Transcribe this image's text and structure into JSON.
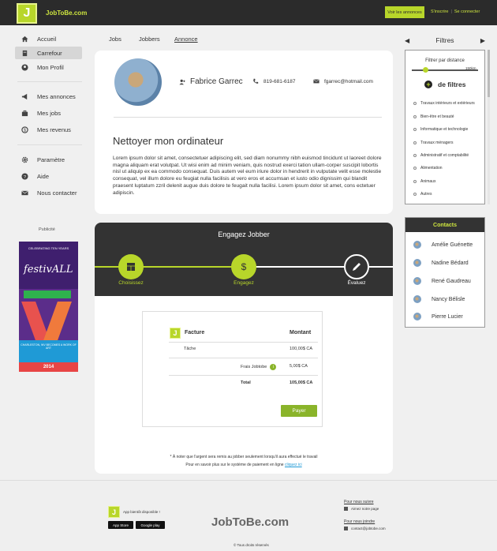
{
  "header": {
    "brand": "JobToBe.com",
    "logo_letter": "J",
    "cta": "Voir les annonces",
    "signup": "S'inscrire",
    "login": "Se connecter"
  },
  "sidebar": {
    "items": [
      {
        "label": "Accueil",
        "icon": "home-icon"
      },
      {
        "label": "Carrefour",
        "icon": "crossroads-icon"
      },
      {
        "label": "Mon Profil",
        "icon": "profile-icon"
      },
      {
        "label": "Mes annonces",
        "icon": "megaphone-icon"
      },
      {
        "label": "Mes jobs",
        "icon": "briefcase-icon"
      },
      {
        "label": "Mes revenus",
        "icon": "money-icon"
      },
      {
        "label": "Paramètre",
        "icon": "gear-icon"
      },
      {
        "label": "Aide",
        "icon": "help-icon"
      },
      {
        "label": "Nous contacter",
        "icon": "mail-icon"
      }
    ],
    "pub_label": "Publicité",
    "ad": {
      "top_text": "CELEBRATING TEN YEARS",
      "title": "festivALL",
      "bottom_text": "CHARLESTON, WV BECOMES A WORK OF ART",
      "year": "2014"
    }
  },
  "tabs": [
    {
      "label": "Jobs"
    },
    {
      "label": "Jobbers"
    },
    {
      "label": "Annonce"
    }
  ],
  "profile": {
    "name": "Fabrice Garrec",
    "phone": "819-681-6187",
    "email": "fgarrec@hotmail.com"
  },
  "job": {
    "title": "Nettoyer mon ordinateur",
    "description": "Lorem ipsum dolor sit amet, consectetuer adipiscing elit, sed diam nonummy nibh euismod tincidunt ut laoreet dolore magna aliquam erat volutpat. Ut wisi enim ad minim veniam, quis nostrud exerci tation ullam-corper suscipit lobortis nisl ut aliquip ex ea commodo consequat. Duis autem vel eum iriure dolor in hendrerit in vulputate velit esse molestie consequat, vel illum dolore eu feugiat nulla facilisis at vero eros et accumsan et iusto odio dignissim qui blandit praesent luptatum zzril delenit augue duis dolore te feugait nulla facilisi. Lorem ipsum dolor sit amet, cons ectetuer adipiscin."
  },
  "engage": {
    "title": "Engagez Jobber",
    "steps": [
      {
        "label": "Choisissez",
        "icon": "grid-icon",
        "state": "done"
      },
      {
        "label": "Engagez",
        "icon": "dollar-icon",
        "state": "active"
      },
      {
        "label": "Évaluez",
        "icon": "pencil-icon",
        "state": "todo"
      }
    ],
    "invoice": {
      "col1": "Facture",
      "col2": "Montant",
      "rows": [
        {
          "label": "Tâche",
          "amount": "100,00$ CA"
        },
        {
          "label": "Frais Jobtobe",
          "amount": "5,00$ CA"
        },
        {
          "label": "Total",
          "amount": "105,00$ CA"
        }
      ],
      "pay": "Payer"
    },
    "note1": "* À noter que l'argent sera remis au jobber seulement lorsqu'il aura effectué le travail",
    "note2_prefix": "Pour en savoir plus sur le système de paiement en ligne",
    "note2_link": "cliquez ici"
  },
  "filters": {
    "title": "Filtres",
    "distance_label": "Filtrer par distance",
    "distance_value": "150km",
    "distance_fraction": 0.2,
    "more_label": "de filtres",
    "items": [
      "Travaux intérieurs et extérieurs",
      "Bien-être et beauté",
      "Informatique et technologie",
      "Travaux ménagers",
      "Administratif et comptabilité",
      "Alimentation",
      "Animaux",
      "Autres"
    ]
  },
  "contacts": {
    "title": "Contacts",
    "items": [
      "Amélie Guénette",
      "Nadine Bédard",
      "René Gaudreau",
      "Nancy Bélisle",
      "Pierre Lucier"
    ]
  },
  "footer": {
    "app_label": "App bientôt disponible !",
    "appstore": "App Store",
    "googleplay": "Google play",
    "brand": "JobToBe.com",
    "follow": "Pour nous suivre",
    "follow_sub": "Aimez notre page",
    "contact": "Pour nous joindre",
    "contact_sub": "contact@jobtobe.com",
    "copyright": "Tous droits réservés"
  },
  "colors": {
    "accent": "#b8d62a",
    "dark": "#2b2b2b",
    "pay": "#8ab42a",
    "link": "#1f9ad6"
  }
}
